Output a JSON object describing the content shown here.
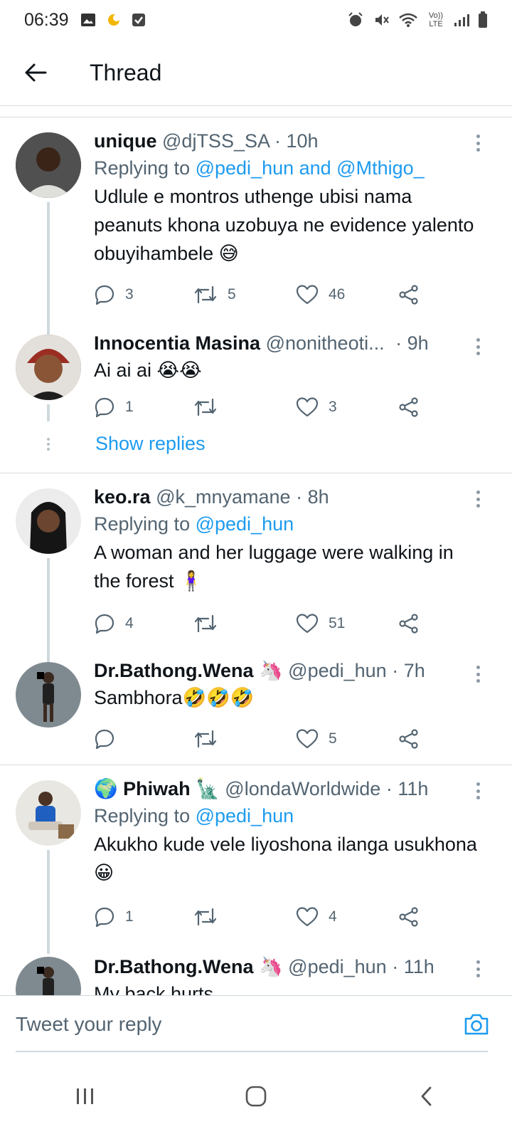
{
  "status_bar": {
    "time": "06:39",
    "network_label": "Vo)) LTE"
  },
  "header": {
    "title": "Thread"
  },
  "tweets": [
    {
      "name": "unique",
      "handle": "@djTSS_SA",
      "time": "· 10h",
      "replying_prefix": "Replying to ",
      "replying_to": "@pedi_hun and @Mthigo_",
      "text": "Udlule e montros  uthenge ubisi nama peanuts    khona uzobuya ne evidence yalento obuyihambele 😅",
      "replies": "3",
      "retweets": "5",
      "likes": "46"
    },
    {
      "name": "Innocentia Masina",
      "handle": "@nonitheoti...",
      "time": "· 9h",
      "text": "Ai ai ai 😭😭",
      "replies": "1",
      "retweets": "",
      "likes": "3"
    },
    {
      "name": "keo.ra",
      "handle": "@k_mnyamane",
      "time": "· 8h",
      "replying_prefix": "Replying to ",
      "replying_to": "@pedi_hun",
      "text": "A woman and her luggage were walking in the forest 🧍‍♀️",
      "replies": "4",
      "retweets": "",
      "likes": "51"
    },
    {
      "name": "Dr.Bathong.Wena 🦄",
      "handle": "@pedi_hun",
      "time": "· 7h",
      "text": "Sambhora🤣🤣🤣",
      "replies": "",
      "retweets": "",
      "likes": "5"
    },
    {
      "name_prefix": "🌍",
      "name": "Phiwah 🗽",
      "handle": "@londaWorldwide",
      "time": "· 11h",
      "replying_prefix": "Replying to ",
      "replying_to": "@pedi_hun",
      "text": "Akukho kude vele liyoshona ilanga usukhona 😀",
      "replies": "1",
      "retweets": "",
      "likes": "4"
    },
    {
      "name": "Dr.Bathong.Wena 🦄",
      "handle": "@pedi_hun",
      "time": "· 11h",
      "text": "My back hurts"
    }
  ],
  "show_replies": "Show replies",
  "compose": {
    "placeholder": "Tweet your reply"
  },
  "colors": {
    "accent": "#1d9bf0",
    "text": "#0f1419",
    "muted": "#536471",
    "divider": "#d9dde1"
  },
  "icons": [
    "back-arrow-icon",
    "reply-icon",
    "retweet-icon",
    "like-icon",
    "share-icon",
    "more-icon",
    "camera-icon",
    "recents-icon",
    "home-icon",
    "nav-back-icon"
  ]
}
